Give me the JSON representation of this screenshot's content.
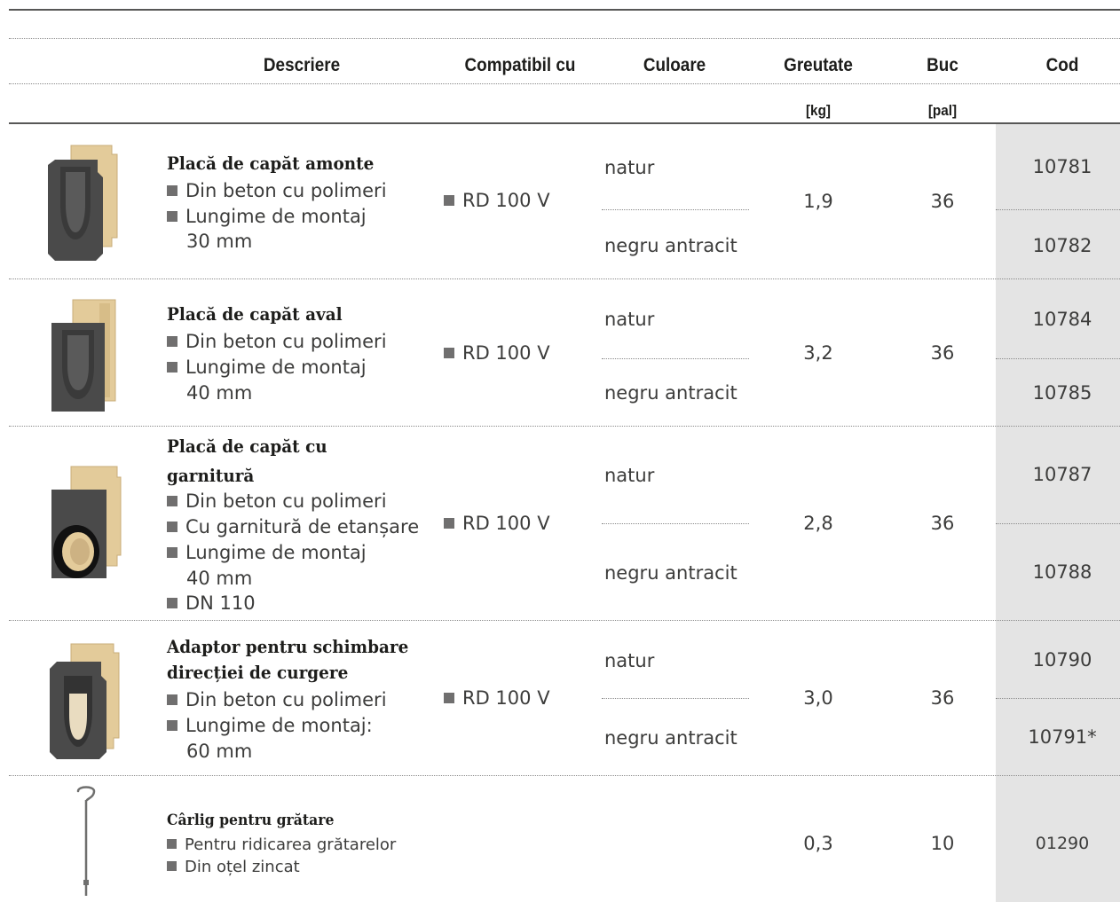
{
  "header": {
    "descriere": "Descriere",
    "compatibil": "Compatibil cu",
    "culoare": "Culoare",
    "greutate": "Greutate",
    "buc": "Buc",
    "cod": "Cod",
    "greutate_unit": "[kg]",
    "buc_unit": "[pal]"
  },
  "products": [
    {
      "title": "Placă de capăt amonte",
      "bullets": [
        "Din beton cu polimeri",
        "Lungime de montaj"
      ],
      "bullet_cont": "30 mm",
      "compat": "RD 100 V",
      "color_1": "natur",
      "color_2": "negru antracit",
      "weight": "1,9",
      "pal": "36",
      "code_1": "10781",
      "code_2": "10782",
      "image_icon": "end-plate-upstream-icon"
    },
    {
      "title": "Placă de capăt aval",
      "bullets": [
        "Din beton cu polimeri",
        "Lungime de montaj"
      ],
      "bullet_cont": "40 mm",
      "compat": "RD 100 V",
      "color_1": "natur",
      "color_2": "negru antracit",
      "weight": "3,2",
      "pal": "36",
      "code_1": "10784",
      "code_2": "10785",
      "image_icon": "end-plate-downstream-icon"
    },
    {
      "title_line_1": "Placă de capăt cu",
      "title_line_2": "garnitură",
      "bullets": [
        "Din beton cu polimeri",
        "Cu garnitură de etanșare",
        "Lungime de montaj",
        "DN 110"
      ],
      "bullet_cont": "40 mm",
      "compat": "RD 100 V",
      "color_1": "natur",
      "color_2": "negru antracit",
      "weight": "2,8",
      "pal": "36",
      "code_1": "10787",
      "code_2": "10788",
      "image_icon": "end-plate-gasket-icon"
    },
    {
      "title_line_1": "Adaptor pentru schimbare",
      "title_line_2": "direcției de curgere",
      "bullets": [
        "Din beton cu polimeri",
        "Lungime de montaj:"
      ],
      "bullet_cont": "60 mm",
      "compat": "RD 100 V",
      "color_1": "natur",
      "color_2": "negru antracit",
      "weight": "3,0",
      "pal": "36",
      "code_1": "10790",
      "code_2": "10791*",
      "image_icon": "flow-direction-adapter-icon"
    },
    {
      "title": "Cârlig pentru grătare",
      "bullets": [
        "Pentru ridicarea grătarelor",
        "Din oțel zincat"
      ],
      "weight": "0,3",
      "pal": "10",
      "code_1": "01290",
      "image_icon": "grate-hook-icon"
    }
  ],
  "colors": {
    "text": "#1d1d1b",
    "code_column": "#e4e4e4",
    "concrete_natur": "#e3cb9a",
    "anthracite": "#4a4a4a"
  }
}
